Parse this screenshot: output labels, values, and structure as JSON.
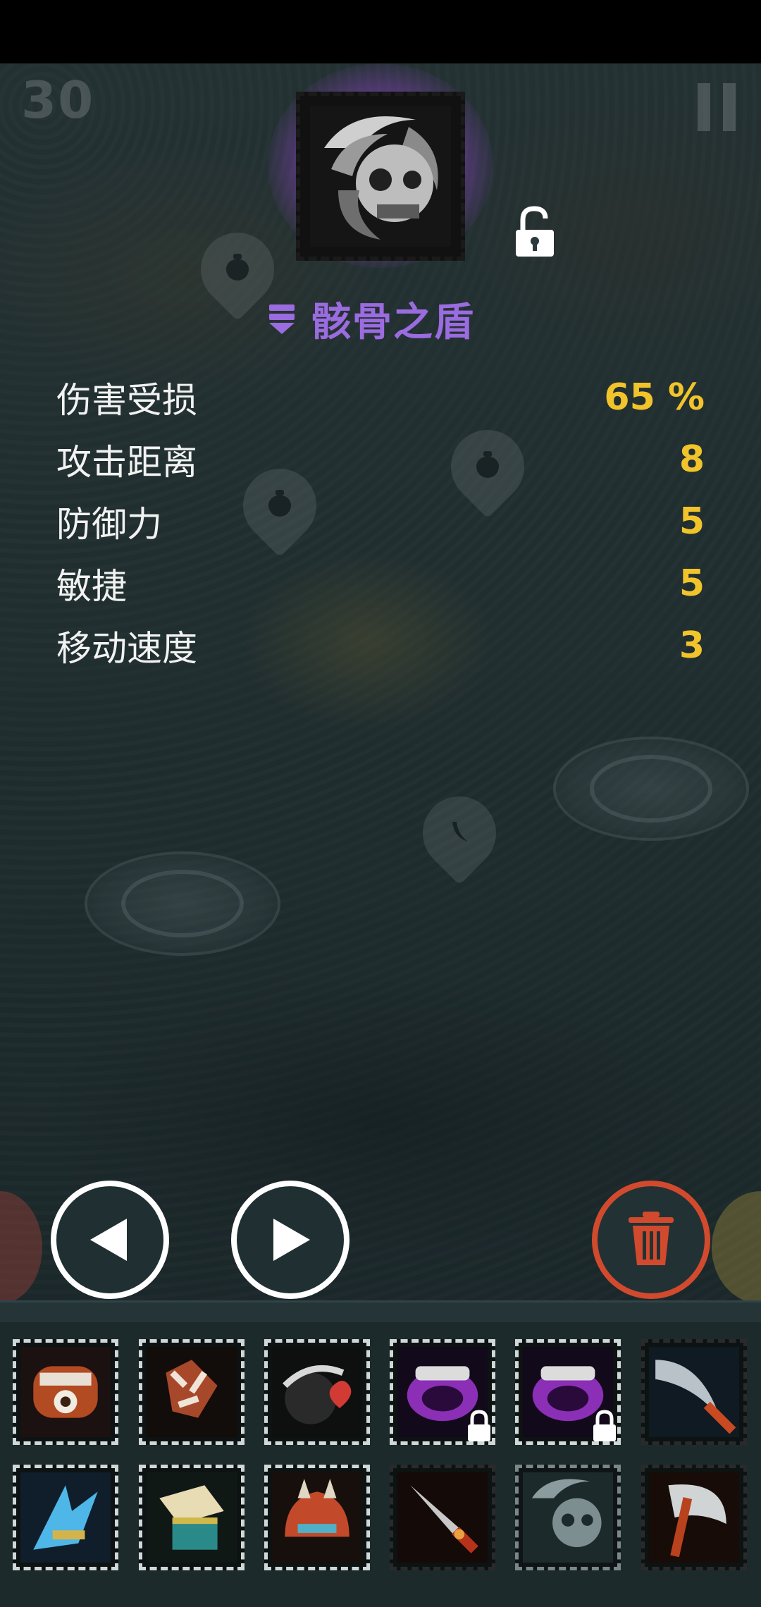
{
  "hud": {
    "turn_counter": "30"
  },
  "item": {
    "name": "骸骨之盾",
    "rarity_color": "#9b6be0",
    "glow_color": "#a850e6",
    "lock_state": "unlocked",
    "icon": "skull-shield-icon"
  },
  "stats": [
    {
      "label": "伤害受损",
      "value": "65 %"
    },
    {
      "label": "攻击距离",
      "value": "8"
    },
    {
      "label": "防御力",
      "value": "5"
    },
    {
      "label": "敏捷",
      "value": "5"
    },
    {
      "label": "移动速度",
      "value": "3"
    }
  ],
  "controls": {
    "prev": "previous-item-button",
    "next": "next-item-button",
    "discard": "discard-item-button",
    "discard_color": "#d24a2e",
    "value_color": "#f2c42c"
  },
  "inventory": {
    "row1": [
      {
        "item": "rusty-bracer-icon",
        "locked": false
      },
      {
        "item": "spiked-gauntlet-icon",
        "locked": false
      },
      {
        "item": "heart-bomb-icon",
        "locked": false
      },
      {
        "item": "purple-ring-icon",
        "locked": true
      },
      {
        "item": "purple-ring-icon",
        "locked": true
      },
      {
        "item": "curved-blade-icon",
        "locked": false
      }
    ],
    "row2": [
      {
        "item": "ice-claw-icon",
        "locked": false
      },
      {
        "item": "scroll-box-icon",
        "locked": false
      },
      {
        "item": "spiked-helmet-icon",
        "locked": false
      },
      {
        "item": "red-dagger-icon",
        "locked": false
      },
      {
        "item": "skull-shield-icon",
        "locked": false
      },
      {
        "item": "battle-axe-icon",
        "locked": false
      }
    ]
  }
}
